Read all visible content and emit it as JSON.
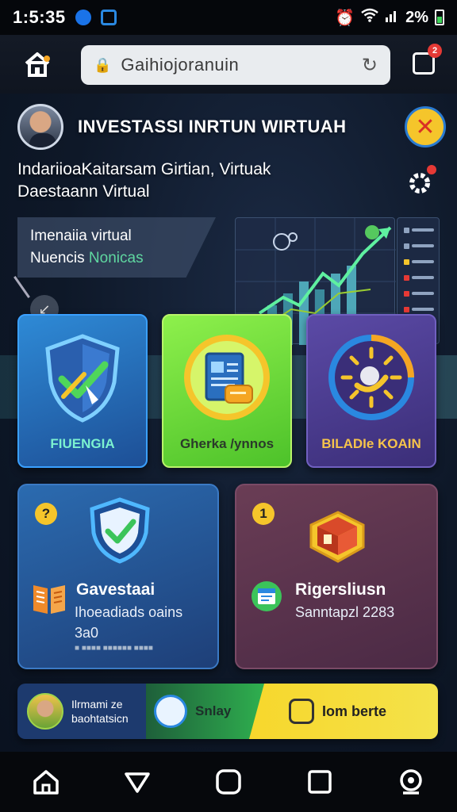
{
  "status_bar": {
    "time": "1:5:35",
    "battery": "2%"
  },
  "browser": {
    "url": "Gaihiojoranuin",
    "lock_icon": "lock-icon",
    "reload_icon": "reload-icon",
    "tabs_badge": "2"
  },
  "header": {
    "title": "INVESTASSI INRTUN WIRTUAH",
    "subtitle_line1": "IndariioaKaitarsam Girtian, Virtuak",
    "subtitle_line2": "Daestaann Virtual"
  },
  "info_card": {
    "line1": "Imenaiia virtual",
    "line2_prefix": "Nuencis ",
    "line2_highlight": "Nonicas"
  },
  "tiles": [
    {
      "label": "FIUENGIA",
      "icon": "shield-check-icon"
    },
    {
      "label": "Gherka /ynnos",
      "icon": "document-card-icon"
    },
    {
      "label": "BILADIe KOAIN",
      "icon": "sun-dial-icon"
    }
  ],
  "cards": [
    {
      "badge": "?",
      "title": "Gavestaai",
      "text": "Ihoeadiads oains",
      "small": "3a0",
      "sub": "■ ■■■■ ■■■■■■ ■■■■",
      "icon": "shield-check-icon",
      "side_icon": "book-icon"
    },
    {
      "badge": "1",
      "title": "Rigersliusn",
      "text": "Sanntapzl 2283",
      "icon": "cube-icon",
      "side_icon": "calendar-icon"
    }
  ],
  "banner": {
    "text_line1": "Ilrmami ze",
    "text_line2": "baohtatsicn",
    "app_label": "Snlay",
    "cta_label": "Iom berte"
  },
  "colors": {
    "accent_green": "#5fd7a0",
    "yellow": "#f5c52b",
    "alert_red": "#e53935"
  }
}
